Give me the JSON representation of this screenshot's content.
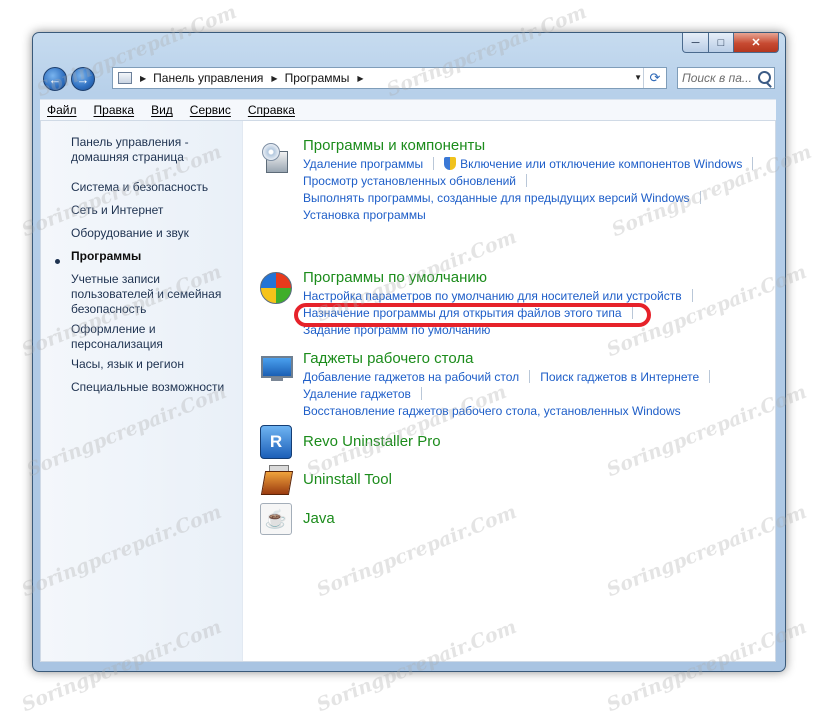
{
  "window": {
    "caption": {
      "minimize": "─",
      "maximize": "□",
      "close": "✕"
    }
  },
  "nav": {
    "back": "←",
    "forward": "→",
    "breadcrumb": [
      "Панель управления",
      "Программы"
    ],
    "search_placeholder": "Поиск в па..."
  },
  "menubar": [
    "Файл",
    "Правка",
    "Вид",
    "Сервис",
    "Справка"
  ],
  "sidebar": {
    "items": [
      "Панель управления - домашняя страница",
      "Система и безопасность",
      "Сеть и Интернет",
      "Оборудование и звук",
      "Программы",
      "Учетные записи пользователей и семейная безопасность",
      "Оформление и персонализация",
      "Часы, язык и регион",
      "Специальные возможности"
    ],
    "current": "Программы"
  },
  "sections": {
    "programs": {
      "title": "Программы и компоненты",
      "links": [
        "Удаление программы",
        "Включение или отключение компонентов Windows",
        "Просмотр установленных обновлений",
        "Выполнять программы, созданные для предыдущих версий Windows",
        "Установка программы"
      ]
    },
    "defaults": {
      "title": "Программы по умолчанию",
      "links": [
        "Настройка параметров по умолчанию для носителей или устройств",
        "Назначение программы для открытия файлов этого типа",
        "Задание программ по умолчанию"
      ]
    },
    "gadgets": {
      "title": "Гаджеты рабочего стола",
      "links": [
        "Добавление гаджетов на рабочий стол",
        "Поиск гаджетов в Интернете",
        "Удаление гаджетов",
        "Восстановление гаджетов рабочего стола, установленных Windows"
      ]
    },
    "revo": {
      "title": "Revo Uninstaller Pro",
      "icon": "R"
    },
    "uninstall_tool": {
      "title": "Uninstall Tool"
    },
    "java": {
      "title": "Java",
      "icon": "☕"
    }
  },
  "watermark": "Soringpcrepair.Com",
  "colors": {
    "highlight": "#e6222a",
    "link": "#1e5ec8",
    "section_title": "#1c8c1c"
  }
}
